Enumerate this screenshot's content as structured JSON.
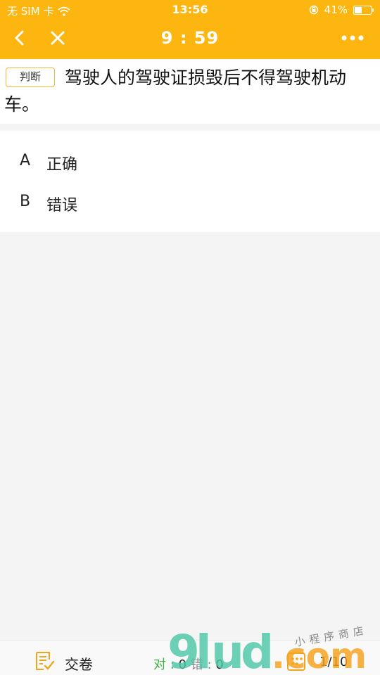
{
  "status_bar": {
    "carrier": "无 SIM 卡",
    "time": "13:56",
    "battery_percent": "41%",
    "battery_level": 0.41,
    "icons": [
      "wifi-icon",
      "rotation-lock-icon",
      "battery-icon"
    ]
  },
  "nav": {
    "timer": "9 : 59",
    "icons": [
      "back-chevron-icon",
      "close-icon",
      "more-dots-icon"
    ]
  },
  "question": {
    "type_tag": "判断",
    "text": "驾驶人的驾驶证损毁后不得驾驶机动车。"
  },
  "options": [
    {
      "letter": "A",
      "text": "正确"
    },
    {
      "letter": "B",
      "text": "错误"
    }
  ],
  "bottom_bar": {
    "submit_label": "交卷",
    "correct_label": "对",
    "correct_count": "0",
    "wrong_label": "错",
    "wrong_count": "0",
    "progress": "1/10",
    "icons": [
      "submit-paper-icon",
      "answer-card-icon"
    ]
  },
  "watermark": {
    "logo_text": "9lud.com",
    "tagline": "小程序商店"
  },
  "colors": {
    "header": "#fdb50f",
    "tag_border": "#f0b53a",
    "correct": "#3cb043",
    "watermark_green": "#4dc8a8",
    "watermark_orange": "#f7a21b"
  }
}
